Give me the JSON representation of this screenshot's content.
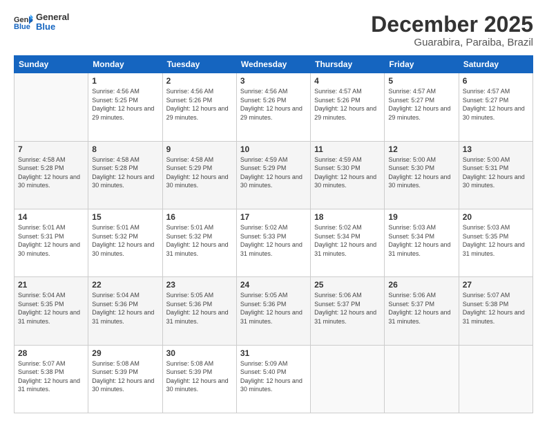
{
  "logo": {
    "line1": "General",
    "line2": "Blue"
  },
  "title": "December 2025",
  "subtitle": "Guarabira, Paraiba, Brazil",
  "weekdays": [
    "Sunday",
    "Monday",
    "Tuesday",
    "Wednesday",
    "Thursday",
    "Friday",
    "Saturday"
  ],
  "weeks": [
    [
      {
        "day": "",
        "sunrise": "",
        "sunset": "",
        "daylight": ""
      },
      {
        "day": "1",
        "sunrise": "Sunrise: 4:56 AM",
        "sunset": "Sunset: 5:25 PM",
        "daylight": "Daylight: 12 hours and 29 minutes."
      },
      {
        "day": "2",
        "sunrise": "Sunrise: 4:56 AM",
        "sunset": "Sunset: 5:26 PM",
        "daylight": "Daylight: 12 hours and 29 minutes."
      },
      {
        "day": "3",
        "sunrise": "Sunrise: 4:56 AM",
        "sunset": "Sunset: 5:26 PM",
        "daylight": "Daylight: 12 hours and 29 minutes."
      },
      {
        "day": "4",
        "sunrise": "Sunrise: 4:57 AM",
        "sunset": "Sunset: 5:26 PM",
        "daylight": "Daylight: 12 hours and 29 minutes."
      },
      {
        "day": "5",
        "sunrise": "Sunrise: 4:57 AM",
        "sunset": "Sunset: 5:27 PM",
        "daylight": "Daylight: 12 hours and 29 minutes."
      },
      {
        "day": "6",
        "sunrise": "Sunrise: 4:57 AM",
        "sunset": "Sunset: 5:27 PM",
        "daylight": "Daylight: 12 hours and 30 minutes."
      }
    ],
    [
      {
        "day": "7",
        "sunrise": "Sunrise: 4:58 AM",
        "sunset": "Sunset: 5:28 PM",
        "daylight": "Daylight: 12 hours and 30 minutes."
      },
      {
        "day": "8",
        "sunrise": "Sunrise: 4:58 AM",
        "sunset": "Sunset: 5:28 PM",
        "daylight": "Daylight: 12 hours and 30 minutes."
      },
      {
        "day": "9",
        "sunrise": "Sunrise: 4:58 AM",
        "sunset": "Sunset: 5:29 PM",
        "daylight": "Daylight: 12 hours and 30 minutes."
      },
      {
        "day": "10",
        "sunrise": "Sunrise: 4:59 AM",
        "sunset": "Sunset: 5:29 PM",
        "daylight": "Daylight: 12 hours and 30 minutes."
      },
      {
        "day": "11",
        "sunrise": "Sunrise: 4:59 AM",
        "sunset": "Sunset: 5:30 PM",
        "daylight": "Daylight: 12 hours and 30 minutes."
      },
      {
        "day": "12",
        "sunrise": "Sunrise: 5:00 AM",
        "sunset": "Sunset: 5:30 PM",
        "daylight": "Daylight: 12 hours and 30 minutes."
      },
      {
        "day": "13",
        "sunrise": "Sunrise: 5:00 AM",
        "sunset": "Sunset: 5:31 PM",
        "daylight": "Daylight: 12 hours and 30 minutes."
      }
    ],
    [
      {
        "day": "14",
        "sunrise": "Sunrise: 5:01 AM",
        "sunset": "Sunset: 5:31 PM",
        "daylight": "Daylight: 12 hours and 30 minutes."
      },
      {
        "day": "15",
        "sunrise": "Sunrise: 5:01 AM",
        "sunset": "Sunset: 5:32 PM",
        "daylight": "Daylight: 12 hours and 30 minutes."
      },
      {
        "day": "16",
        "sunrise": "Sunrise: 5:01 AM",
        "sunset": "Sunset: 5:32 PM",
        "daylight": "Daylight: 12 hours and 31 minutes."
      },
      {
        "day": "17",
        "sunrise": "Sunrise: 5:02 AM",
        "sunset": "Sunset: 5:33 PM",
        "daylight": "Daylight: 12 hours and 31 minutes."
      },
      {
        "day": "18",
        "sunrise": "Sunrise: 5:02 AM",
        "sunset": "Sunset: 5:34 PM",
        "daylight": "Daylight: 12 hours and 31 minutes."
      },
      {
        "day": "19",
        "sunrise": "Sunrise: 5:03 AM",
        "sunset": "Sunset: 5:34 PM",
        "daylight": "Daylight: 12 hours and 31 minutes."
      },
      {
        "day": "20",
        "sunrise": "Sunrise: 5:03 AM",
        "sunset": "Sunset: 5:35 PM",
        "daylight": "Daylight: 12 hours and 31 minutes."
      }
    ],
    [
      {
        "day": "21",
        "sunrise": "Sunrise: 5:04 AM",
        "sunset": "Sunset: 5:35 PM",
        "daylight": "Daylight: 12 hours and 31 minutes."
      },
      {
        "day": "22",
        "sunrise": "Sunrise: 5:04 AM",
        "sunset": "Sunset: 5:36 PM",
        "daylight": "Daylight: 12 hours and 31 minutes."
      },
      {
        "day": "23",
        "sunrise": "Sunrise: 5:05 AM",
        "sunset": "Sunset: 5:36 PM",
        "daylight": "Daylight: 12 hours and 31 minutes."
      },
      {
        "day": "24",
        "sunrise": "Sunrise: 5:05 AM",
        "sunset": "Sunset: 5:36 PM",
        "daylight": "Daylight: 12 hours and 31 minutes."
      },
      {
        "day": "25",
        "sunrise": "Sunrise: 5:06 AM",
        "sunset": "Sunset: 5:37 PM",
        "daylight": "Daylight: 12 hours and 31 minutes."
      },
      {
        "day": "26",
        "sunrise": "Sunrise: 5:06 AM",
        "sunset": "Sunset: 5:37 PM",
        "daylight": "Daylight: 12 hours and 31 minutes."
      },
      {
        "day": "27",
        "sunrise": "Sunrise: 5:07 AM",
        "sunset": "Sunset: 5:38 PM",
        "daylight": "Daylight: 12 hours and 31 minutes."
      }
    ],
    [
      {
        "day": "28",
        "sunrise": "Sunrise: 5:07 AM",
        "sunset": "Sunset: 5:38 PM",
        "daylight": "Daylight: 12 hours and 31 minutes."
      },
      {
        "day": "29",
        "sunrise": "Sunrise: 5:08 AM",
        "sunset": "Sunset: 5:39 PM",
        "daylight": "Daylight: 12 hours and 30 minutes."
      },
      {
        "day": "30",
        "sunrise": "Sunrise: 5:08 AM",
        "sunset": "Sunset: 5:39 PM",
        "daylight": "Daylight: 12 hours and 30 minutes."
      },
      {
        "day": "31",
        "sunrise": "Sunrise: 5:09 AM",
        "sunset": "Sunset: 5:40 PM",
        "daylight": "Daylight: 12 hours and 30 minutes."
      },
      {
        "day": "",
        "sunrise": "",
        "sunset": "",
        "daylight": ""
      },
      {
        "day": "",
        "sunrise": "",
        "sunset": "",
        "daylight": ""
      },
      {
        "day": "",
        "sunrise": "",
        "sunset": "",
        "daylight": ""
      }
    ]
  ]
}
